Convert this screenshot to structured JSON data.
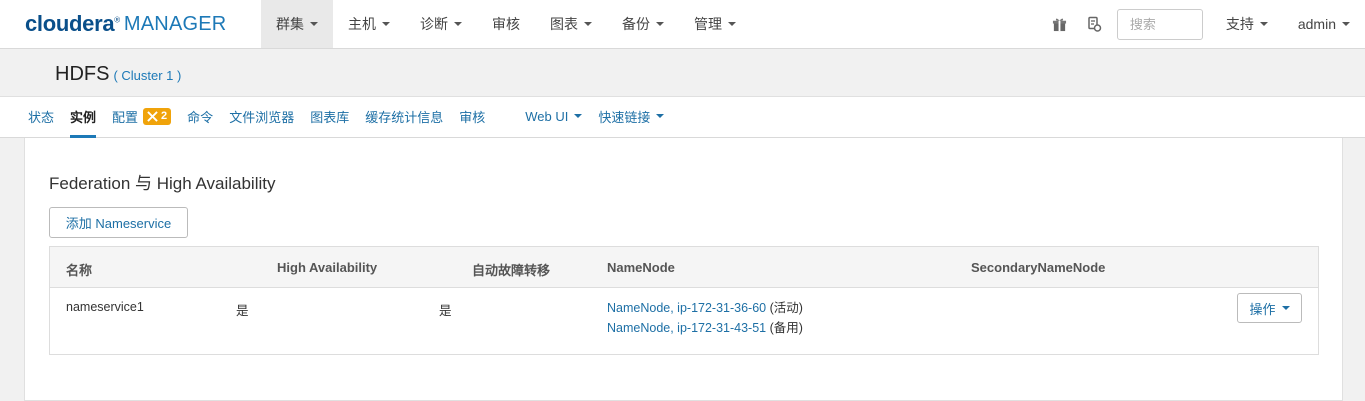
{
  "topnav": {
    "logo_brand": "cloudera",
    "logo_reg": "®",
    "logo_product": "MANAGER",
    "items": [
      {
        "label": "群集"
      },
      {
        "label": "主机"
      },
      {
        "label": "诊断"
      },
      {
        "label": "审核"
      },
      {
        "label": "图表"
      },
      {
        "label": "备份"
      },
      {
        "label": "管理"
      }
    ],
    "search_placeholder": "搜索",
    "support_label": "支持",
    "user_label": "admin"
  },
  "service": {
    "name": "HDFS",
    "cluster": "( Cluster 1 )"
  },
  "tabs": [
    {
      "label": "状态"
    },
    {
      "label": "实例"
    },
    {
      "label": "配置"
    },
    {
      "label": "命令"
    },
    {
      "label": "文件浏览器"
    },
    {
      "label": "图表库"
    },
    {
      "label": "缓存统计信息"
    },
    {
      "label": "审核"
    },
    {
      "label": "Web UI"
    },
    {
      "label": "快速链接"
    }
  ],
  "config_badge": "2",
  "section": {
    "title": "Federation 与 High Availability",
    "add_button": "添加 Nameservice"
  },
  "table": {
    "headers": [
      "名称",
      "High Availability",
      "自动故障转移",
      "NameNode",
      "SecondaryNameNode"
    ],
    "rows": [
      {
        "name": "nameservice1",
        "high_availability": "是",
        "auto_failover": "是",
        "namenodes": [
          {
            "link": "NameNode, ip-172-31-36-60",
            "status": "(活动)"
          },
          {
            "link": "NameNode, ip-172-31-43-51",
            "status": "(备用)"
          }
        ],
        "action_label": "操作"
      }
    ]
  },
  "colors": {
    "brand_dark": "#0a4f8a",
    "link_blue": "#1d6fa5",
    "badge_orange": "#f0a30a"
  }
}
